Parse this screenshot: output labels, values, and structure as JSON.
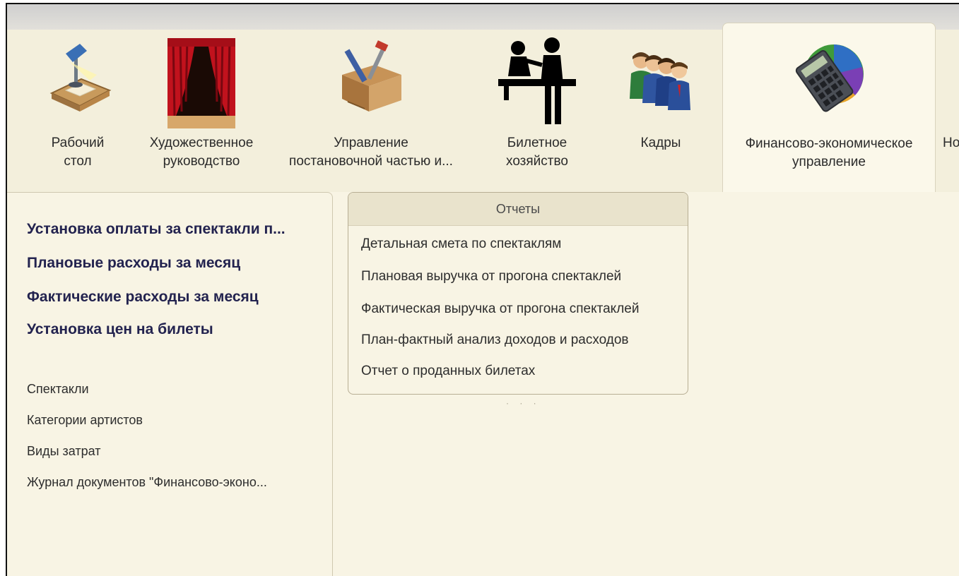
{
  "sections": [
    {
      "id": "desktop",
      "label_lines": [
        "Рабочий",
        "стол"
      ],
      "icon": "desk-lamp-icon"
    },
    {
      "id": "art",
      "label_lines": [
        "Художественное",
        "руководство"
      ],
      "icon": "theater-curtain-icon"
    },
    {
      "id": "production",
      "label_lines": [
        "Управление",
        "постановочной частью и..."
      ],
      "icon": "toolbox-icon"
    },
    {
      "id": "tickets",
      "label_lines": [
        "Билетное",
        "хозяйство"
      ],
      "icon": "ticket-counter-icon"
    },
    {
      "id": "staff",
      "label_lines": [
        "Кадры",
        ""
      ],
      "icon": "people-icon"
    },
    {
      "id": "finance",
      "label_lines": [
        "Финансово-экономическое",
        "управление"
      ],
      "icon": "calculator-pie-icon"
    },
    {
      "id": "more",
      "label_lines": [
        "Но",
        ""
      ],
      "icon": ""
    }
  ],
  "left_panel": {
    "bold_links": [
      "Установка оплаты за спектакли п...",
      "Плановые расходы за месяц",
      "Фактические расходы за месяц",
      "Установка цен на билеты"
    ],
    "plain_links": [
      "Спектакли",
      "Категории артистов",
      "Виды затрат",
      "Журнал документов \"Финансово-эконо..."
    ]
  },
  "reports": {
    "title": "Отчеты",
    "items": [
      "Детальная смета по спектаклям",
      "Плановая выручка от прогона спектаклей",
      "Фактическая выручка от прогона спектаклей",
      "План-фактный анализ доходов и расходов",
      "Отчет о проданных билетах"
    ]
  },
  "colors": {
    "background": "#f5f1e2",
    "bold_link": "#23234f",
    "active_tab": "#fbf8ea"
  }
}
